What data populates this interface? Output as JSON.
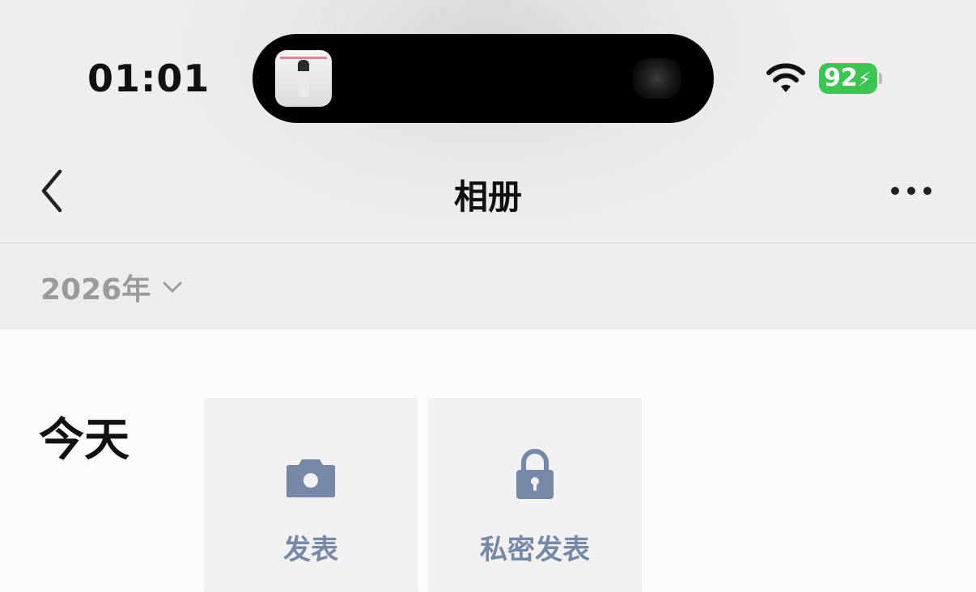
{
  "status_bar": {
    "time": "01:01",
    "battery_level": "92",
    "battery_color": "#3ec455",
    "wifi_icon": "wifi-icon",
    "charging_icon": "bolt-icon"
  },
  "nav": {
    "back_icon": "chevron-left-icon",
    "title": "相册",
    "more_icon": "ellipsis-icon"
  },
  "year_filter": {
    "label": "2026年",
    "icon": "chevron-down-icon"
  },
  "feed": {
    "day_label": "今天",
    "tiles": [
      {
        "label": "发表",
        "icon": "camera-icon"
      },
      {
        "label": "私密发表",
        "icon": "lock-icon"
      }
    ],
    "accent_color": "#7688a6"
  }
}
